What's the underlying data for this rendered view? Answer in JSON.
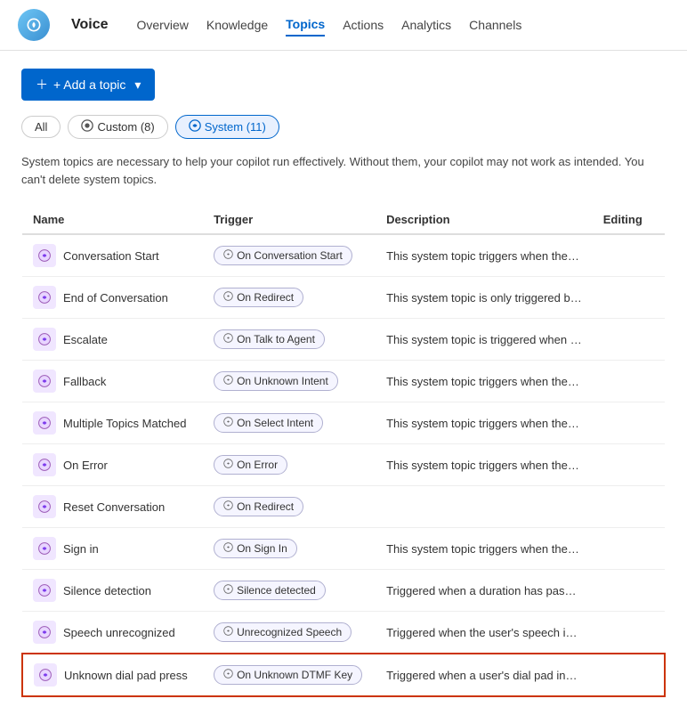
{
  "header": {
    "app_name": "Voice",
    "nav_items": [
      {
        "label": "Overview",
        "active": false
      },
      {
        "label": "Knowledge",
        "active": false
      },
      {
        "label": "Topics",
        "active": true
      },
      {
        "label": "Actions",
        "active": false
      },
      {
        "label": "Analytics",
        "active": false
      },
      {
        "label": "Channels",
        "active": false
      }
    ]
  },
  "toolbar": {
    "add_button_label": "+ Add a topic"
  },
  "filters": {
    "tabs": [
      {
        "label": "All",
        "active": false
      },
      {
        "label": "Custom (8)",
        "active": false,
        "has_icon": true
      },
      {
        "label": "System (11)",
        "active": true,
        "has_icon": true
      }
    ]
  },
  "info_text": "System topics are necessary to help your copilot run effectively. Without them, your copilot may not work as intended. You can't delete system topics.",
  "table": {
    "columns": [
      "Name",
      "Trigger",
      "Description",
      "Editing"
    ],
    "rows": [
      {
        "name": "Conversation Start",
        "trigger": "On Conversation Start",
        "description": "This system topic triggers when the b...",
        "highlighted": false
      },
      {
        "name": "End of Conversation",
        "trigger": "On Redirect",
        "description": "This system topic is only triggered by ...",
        "highlighted": false
      },
      {
        "name": "Escalate",
        "trigger": "On Talk to Agent",
        "description": "This system topic is triggered when t...",
        "highlighted": false
      },
      {
        "name": "Fallback",
        "trigger": "On Unknown Intent",
        "description": "This system topic triggers when the u...",
        "highlighted": false
      },
      {
        "name": "Multiple Topics Matched",
        "trigger": "On Select Intent",
        "description": "This system topic triggers when the b...",
        "highlighted": false
      },
      {
        "name": "On Error",
        "trigger": "On Error",
        "description": "This system topic triggers when the b...",
        "highlighted": false
      },
      {
        "name": "Reset Conversation",
        "trigger": "On Redirect",
        "description": "",
        "highlighted": false
      },
      {
        "name": "Sign in",
        "trigger": "On Sign In",
        "description": "This system topic triggers when the b...",
        "highlighted": false
      },
      {
        "name": "Silence detection",
        "trigger": "Silence detected",
        "description": "Triggered when a duration has passe...",
        "highlighted": false
      },
      {
        "name": "Speech unrecognized",
        "trigger": "Unrecognized Speech",
        "description": "Triggered when the user's speech inp...",
        "highlighted": false
      },
      {
        "name": "Unknown dial pad press",
        "trigger": "On Unknown DTMF Key",
        "description": "Triggered when a user's dial pad inpu...",
        "highlighted": true
      }
    ]
  }
}
